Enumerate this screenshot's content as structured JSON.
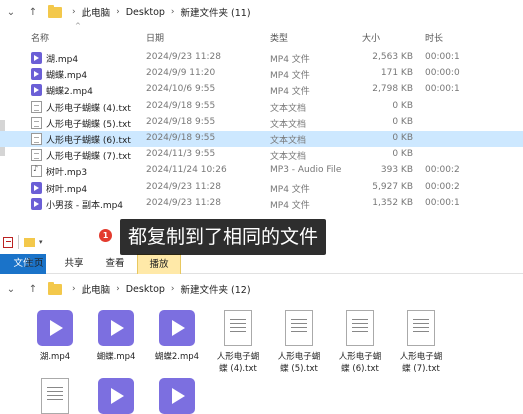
{
  "top_window": {
    "breadcrumb": [
      "此电脑",
      "Desktop",
      "新建文件夹 (11)"
    ],
    "columns": [
      "名称",
      "日期",
      "类型",
      "大小",
      "时长"
    ],
    "files": [
      {
        "name": "湖.mp4",
        "date": "2024/9/23 11:28",
        "type": "MP4 文件",
        "size": "2,563 KB",
        "dur": "00:00:1",
        "icon": "video"
      },
      {
        "name": "蝴蝶.mp4",
        "date": "2024/9/9 11:20",
        "type": "MP4 文件",
        "size": "171 KB",
        "dur": "00:00:0",
        "icon": "video"
      },
      {
        "name": "蝴蝶2.mp4",
        "date": "2024/10/6 9:55",
        "type": "MP4 文件",
        "size": "2,798 KB",
        "dur": "00:00:1",
        "icon": "video"
      },
      {
        "name": "人形电子蝴蝶 (4).txt",
        "date": "2024/9/18 9:55",
        "type": "文本文档",
        "size": "0 KB",
        "dur": "",
        "icon": "text"
      },
      {
        "name": "人形电子蝴蝶 (5).txt",
        "date": "2024/9/18 9:55",
        "type": "文本文档",
        "size": "0 KB",
        "dur": "",
        "icon": "text"
      },
      {
        "name": "人形电子蝴蝶 (6).txt",
        "date": "2024/9/18 9:55",
        "type": "文本文档",
        "size": "0 KB",
        "dur": "",
        "icon": "text",
        "selected": true
      },
      {
        "name": "人形电子蝴蝶 (7).txt",
        "date": "2024/11/3 9:55",
        "type": "文本文档",
        "size": "0 KB",
        "dur": "",
        "icon": "text"
      },
      {
        "name": "树叶.mp3",
        "date": "2024/11/24 10:26",
        "type": "MP3 - Audio File",
        "size": "393 KB",
        "dur": "00:00:2",
        "icon": "audio"
      },
      {
        "name": "树叶.mp4",
        "date": "2024/9/23 11:28",
        "type": "MP4 文件",
        "size": "5,927 KB",
        "dur": "00:00:2",
        "icon": "video"
      },
      {
        "name": "小男孩 - 副本.mp4",
        "date": "2024/9/23 11:28",
        "type": "MP4 文件",
        "size": "1,352 KB",
        "dur": "00:00:1",
        "icon": "video"
      }
    ]
  },
  "caption": {
    "badge": "1",
    "text": "都复制到了相同的文件"
  },
  "bottom_window": {
    "ribbon_tabs": [
      "文件",
      "主页",
      "共享",
      "查看",
      "播放"
    ],
    "breadcrumb": [
      "此电脑",
      "Desktop",
      "新建文件夹 (12)"
    ],
    "tiles": [
      {
        "label": "湖.mp4",
        "icon": "video"
      },
      {
        "label": "蝴蝶.mp4",
        "icon": "video"
      },
      {
        "label": "蝴蝶2.mp4",
        "icon": "video"
      },
      {
        "label": "人形电子蝴\n蝶 (4).txt",
        "icon": "text"
      },
      {
        "label": "人形电子蝴\n蝶 (5).txt",
        "icon": "text"
      },
      {
        "label": "人形电子蝴\n蝶 (6).txt",
        "icon": "text"
      },
      {
        "label": "人形电子蝴\n蝶 (7).txt",
        "icon": "text"
      }
    ]
  }
}
